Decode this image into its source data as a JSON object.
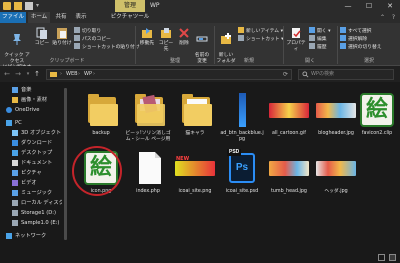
{
  "titlebar": {
    "context_tab": "管理",
    "window_title": "WP",
    "controls": {
      "minimize": "—",
      "maximize": "☐",
      "close": "✕"
    },
    "qa_dropdown": "▾"
  },
  "ribbon_tabs": {
    "file": "ファイル",
    "home": "ホーム",
    "share": "共有",
    "view": "表示",
    "picture_tools": "ピクチャツール",
    "collapse": "⌃",
    "help": "?"
  },
  "ribbon": {
    "pin_quick_access": "クイック アクセス\nにピン留めする",
    "copy": "コピー",
    "paste": "貼り付け",
    "cut": "切り取り",
    "copy_path": "パスのコピー",
    "paste_shortcut": "ショートカットの貼り付け",
    "move_to": "移動先",
    "copy_to": "コピー先",
    "delete": "削除",
    "rename": "名前の\n変更",
    "new_folder": "新しい\nフォルダー",
    "new_item": "新しいアイテム ▾",
    "shortcut": "ショートカット ▾",
    "properties": "プロパティ",
    "open": "開く ▾",
    "edit": "編集",
    "history": "履歴",
    "select_all": "すべて選択",
    "select_none": "選択解除",
    "invert_selection": "選択の切り替え",
    "group_clipboard": "クリップボード",
    "group_organize": "整理",
    "group_new": "新規",
    "group_open": "開く",
    "group_select": "選択"
  },
  "navbar": {
    "back": "←",
    "forward": "→",
    "recent": "▾",
    "up": "↑",
    "crumbs": [
      "›",
      "WEB",
      "›",
      "WP",
      "›"
    ],
    "refresh": "⟳",
    "search_placeholder": "WPの検索"
  },
  "sidebar": {
    "items": [
      {
        "label": "音楽",
        "icon": "music-icon"
      },
      {
        "label": "画像・素材",
        "icon": "folder-icon"
      },
      {
        "label": "OneDrive",
        "icon": "onedrive-icon"
      },
      {
        "label": "PC",
        "icon": "pc-icon"
      },
      {
        "label": "3D オブジェクト",
        "icon": "3d-icon"
      },
      {
        "label": "ダウンロード",
        "icon": "download-icon"
      },
      {
        "label": "デスクトップ",
        "icon": "desktop-icon"
      },
      {
        "label": "ドキュメント",
        "icon": "document-icon"
      },
      {
        "label": "ピクチャ",
        "icon": "picture-icon"
      },
      {
        "label": "ビデオ",
        "icon": "video-icon"
      },
      {
        "label": "ミュージック",
        "icon": "music-icon"
      },
      {
        "label": "ローカル ディスク (C:)",
        "icon": "drive-icon"
      },
      {
        "label": "Storage1 (D:)",
        "icon": "drive-icon"
      },
      {
        "label": "Sample1.0 (E:)",
        "icon": "drive-icon"
      },
      {
        "label": "ネットワーク",
        "icon": "network-icon"
      }
    ]
  },
  "files": [
    {
      "name": "backup",
      "kind": "folder"
    },
    {
      "name": "ビーッ!ソリン消しゴム・シール ページ用",
      "kind": "folder-images"
    },
    {
      "name": "猫キャラ",
      "kind": "folder-paper"
    },
    {
      "name": "ad_btn_backblue.jpg",
      "kind": "blue-bar"
    },
    {
      "name": "all_cartoon.gif",
      "kind": "banner-red"
    },
    {
      "name": "blogheader.jpg",
      "kind": "banner-multi"
    },
    {
      "name": "favicon2.clip",
      "kind": "kanji"
    },
    {
      "name": "icon.png",
      "kind": "kanji"
    },
    {
      "name": "index.php",
      "kind": "page"
    },
    {
      "name": "icoai_site.png",
      "kind": "banner-new"
    },
    {
      "name": "icoai_site.psd",
      "kind": "psd"
    },
    {
      "name": "tumb_head.jpg",
      "kind": "banner-multi"
    },
    {
      "name": "ヘッダ.jpg",
      "kind": "banner-multi2"
    }
  ],
  "thumb_text": {
    "kanji": "絵",
    "psd": "Ps",
    "psd_label": "PSD",
    "new_label": "NEW"
  },
  "status": {
    "text": ""
  },
  "colors": {
    "accent_file_tab": "#1a6fb5",
    "context_tab": "#cfc06a",
    "annotation": "#c4242a",
    "folder": "#f2cd62"
  }
}
